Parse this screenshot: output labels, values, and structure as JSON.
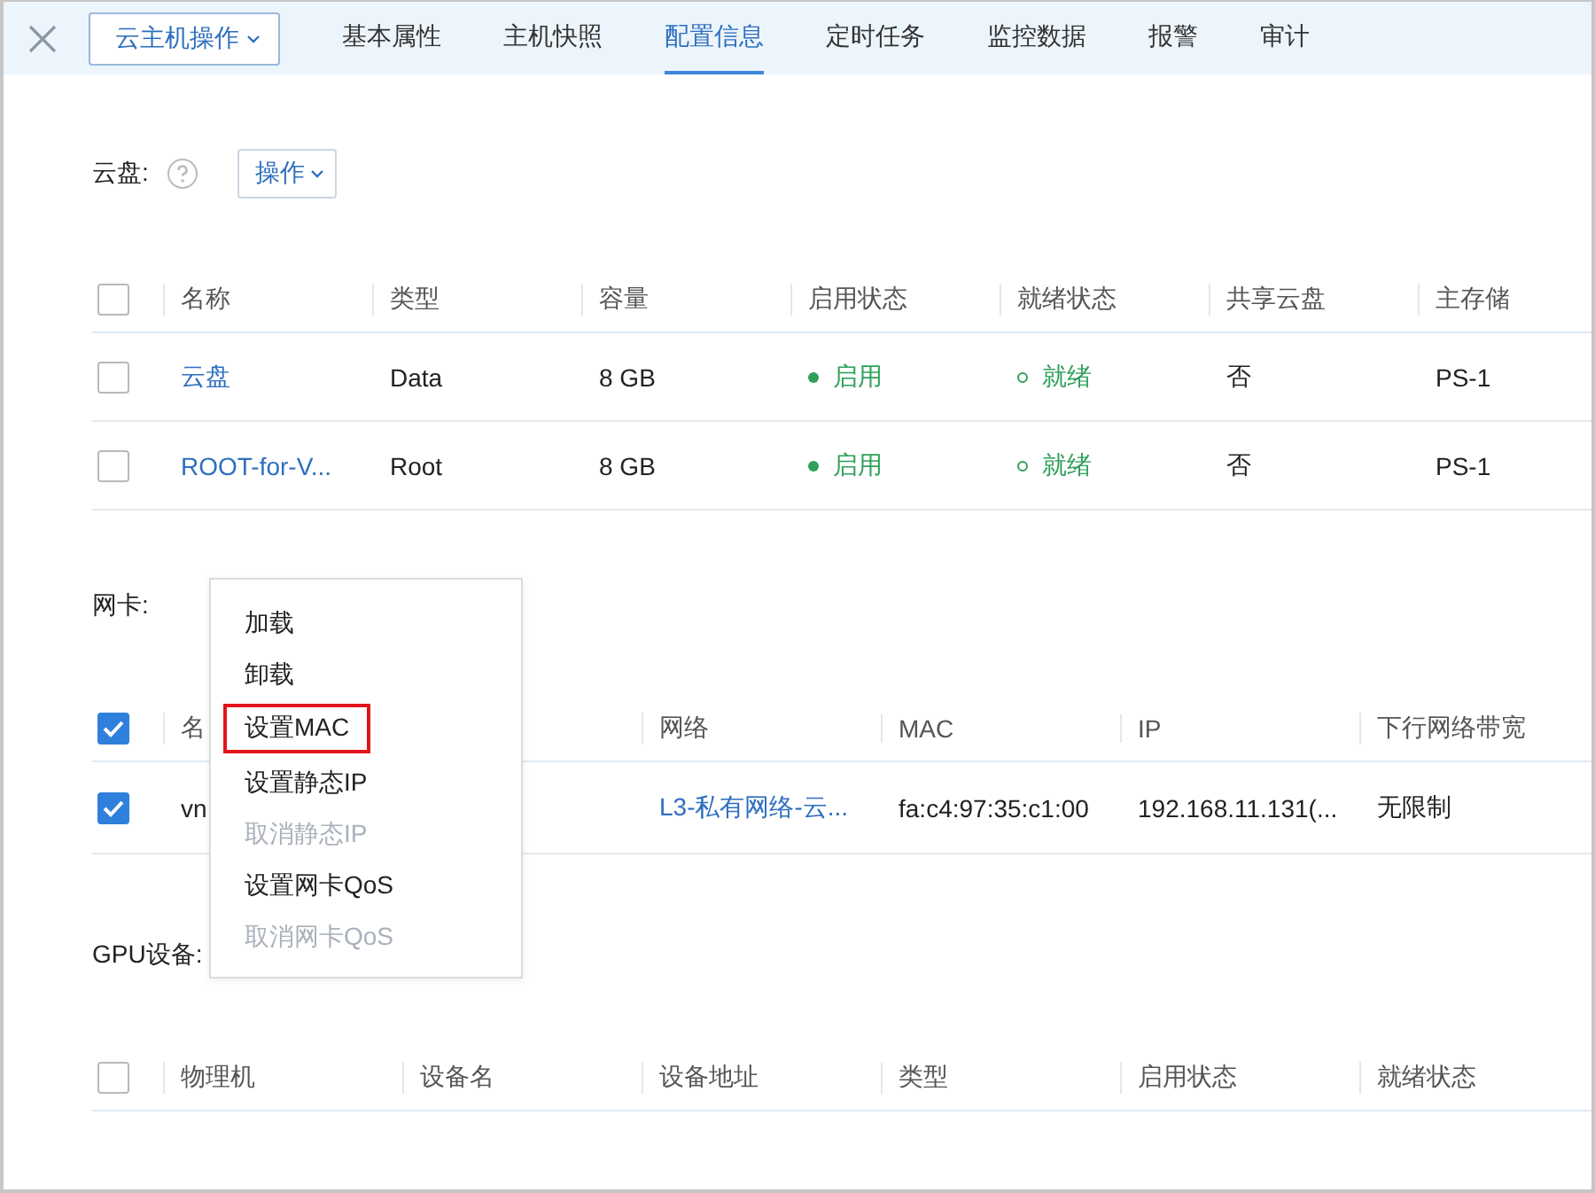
{
  "top_bar": {
    "action_button": "云主机操作",
    "tabs": [
      {
        "label": "基本属性",
        "selected": false
      },
      {
        "label": "主机快照",
        "selected": false
      },
      {
        "label": "配置信息",
        "selected": true
      },
      {
        "label": "定时任务",
        "selected": false
      },
      {
        "label": "监控数据",
        "selected": false
      },
      {
        "label": "报警",
        "selected": false
      },
      {
        "label": "审计",
        "selected": false
      }
    ]
  },
  "disk_section": {
    "label": "云盘:",
    "action_button": "操作",
    "table": {
      "header_checked": false,
      "columns": [
        "名称",
        "类型",
        "容量",
        "启用状态",
        "就绪状态",
        "共享云盘",
        "主存储"
      ],
      "rows": [
        {
          "checked": false,
          "name": "云盘",
          "type": "Data",
          "size": "8 GB",
          "enable_state": "启用",
          "ready_state": "就绪",
          "shared": "否",
          "primary_storage": "PS-1"
        },
        {
          "checked": false,
          "name": "ROOT-for-V...",
          "type": "Root",
          "size": "8 GB",
          "enable_state": "启用",
          "ready_state": "就绪",
          "shared": "否",
          "primary_storage": "PS-1"
        }
      ]
    }
  },
  "nic_section": {
    "label": "网卡:",
    "table": {
      "header_checked": true,
      "columns": [
        "名",
        "网络",
        "MAC",
        "IP",
        "下行网络带宽"
      ],
      "rows": [
        {
          "checked": true,
          "name": "vn",
          "network": "L3-私有网络-云...",
          "mac": "fa:c4:97:35:c1:00",
          "ip": "192.168.11.131(...",
          "downlink_bandwidth": "无限制"
        }
      ]
    }
  },
  "gpu_section": {
    "label": "GPU设备:",
    "table": {
      "header_checked": false,
      "columns": [
        "物理机",
        "设备名",
        "设备地址",
        "类型",
        "启用状态",
        "就绪状态"
      ]
    }
  },
  "dropdown_menu": {
    "items": [
      {
        "label": "加载",
        "disabled": false,
        "highlighted": false
      },
      {
        "label": "卸载",
        "disabled": false,
        "highlighted": false
      },
      {
        "label": "设置MAC",
        "disabled": false,
        "highlighted": true
      },
      {
        "label": "设置静态IP",
        "disabled": false,
        "highlighted": false
      },
      {
        "label": "取消静态IP",
        "disabled": true,
        "highlighted": false
      },
      {
        "label": "设置网卡QoS",
        "disabled": false,
        "highlighted": false
      },
      {
        "label": "取消网卡QoS",
        "disabled": true,
        "highlighted": false
      }
    ]
  }
}
